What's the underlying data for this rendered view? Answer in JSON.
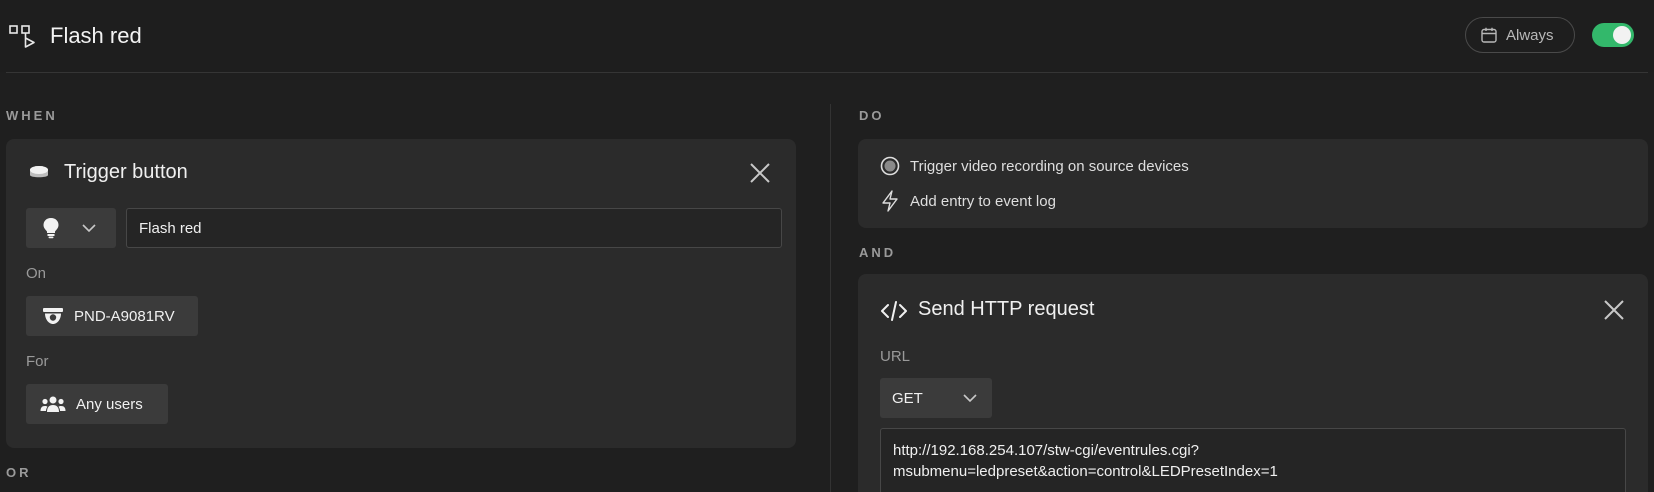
{
  "header": {
    "title": "Flash red",
    "schedule_label": "Always",
    "enabled": true
  },
  "when": {
    "section_label": "WHEN",
    "trigger_card": {
      "title": "Trigger button",
      "icon_type": "lightbulb-icon",
      "name_value": "Flash red",
      "on_label": "On",
      "device_name": "PND-A9081RV",
      "for_label": "For",
      "users_label": "Any users"
    },
    "or_label": "OR"
  },
  "do": {
    "section_label": "DO",
    "items": [
      {
        "icon": "record-icon",
        "label": "Trigger video recording on source devices"
      },
      {
        "icon": "lightning-icon",
        "label": "Add entry to event log"
      }
    ],
    "and_label": "AND",
    "http_card": {
      "title": "Send HTTP request",
      "url_label": "URL",
      "method": "GET",
      "url_line1": "http://192.168.254.107/stw-cgi/eventrules.cgi?",
      "url_line2": "msubmenu=ledpreset&action=control&LEDPresetIndex=1"
    }
  },
  "colors": {
    "background": "#1f1f1f",
    "card": "#2b2b2b",
    "toggle_on": "#33b86b"
  }
}
